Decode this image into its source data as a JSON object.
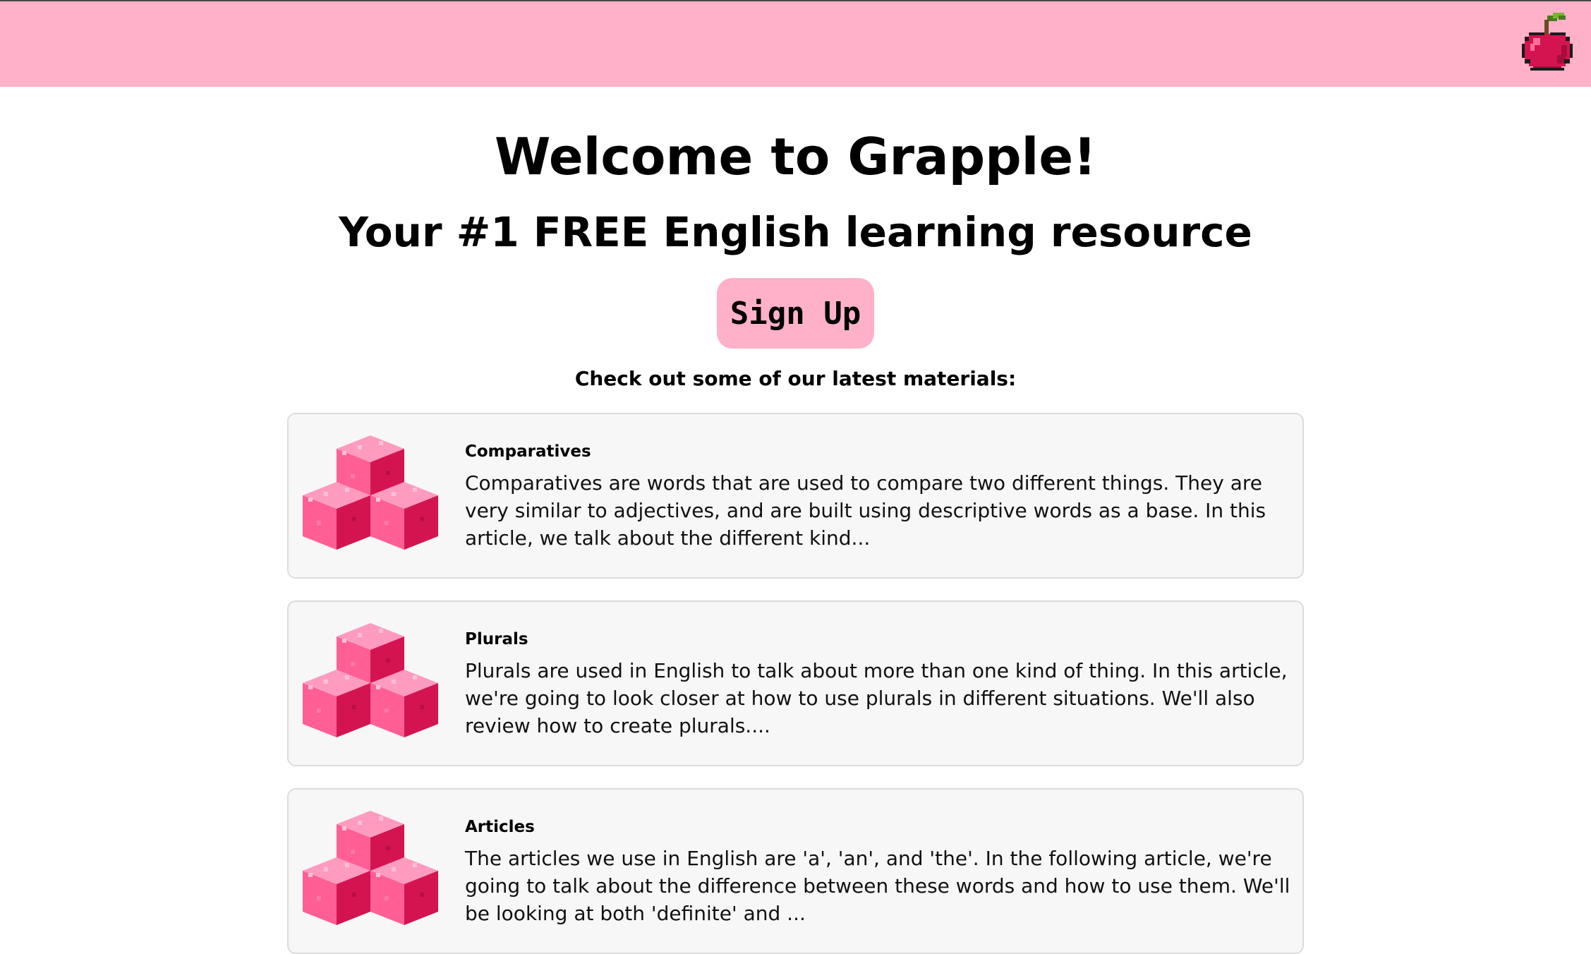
{
  "header": {
    "logo_icon": "cherry-icon",
    "background_color": "#ffb1c9"
  },
  "hero": {
    "title": "Welcome to Grapple!",
    "subtitle": "Your #1 FREE English learning resource",
    "signup_label": "Sign Up"
  },
  "materials": {
    "heading": "Check out some of our latest materials:",
    "items": [
      {
        "icon": "pink-cubes-icon",
        "title": "Comparatives",
        "description": "Comparatives are words that are used to compare two different things. They are very similar to adjectives, and are built using descriptive words as a base. In this article, we talk about the different kind..."
      },
      {
        "icon": "pink-cubes-icon",
        "title": "Plurals",
        "description": "Plurals are used in English to talk about more than one kind of thing. In this article, we're going to look closer at how to use plurals in different situations. We'll also review how to create plurals...."
      },
      {
        "icon": "pink-cubes-icon",
        "title": "Articles",
        "description": "The articles we use in English are 'a', 'an', and 'the'. In the following article, we're going to talk about the difference between these words and how to use them. We'll be looking at both 'definite' and ..."
      }
    ]
  },
  "colors": {
    "accent": "#ffb1c9",
    "card_background": "#f7f7f7",
    "cube_light": "#ff5f94",
    "cube_dark": "#d41451",
    "cube_top": "#ff9bbf"
  }
}
